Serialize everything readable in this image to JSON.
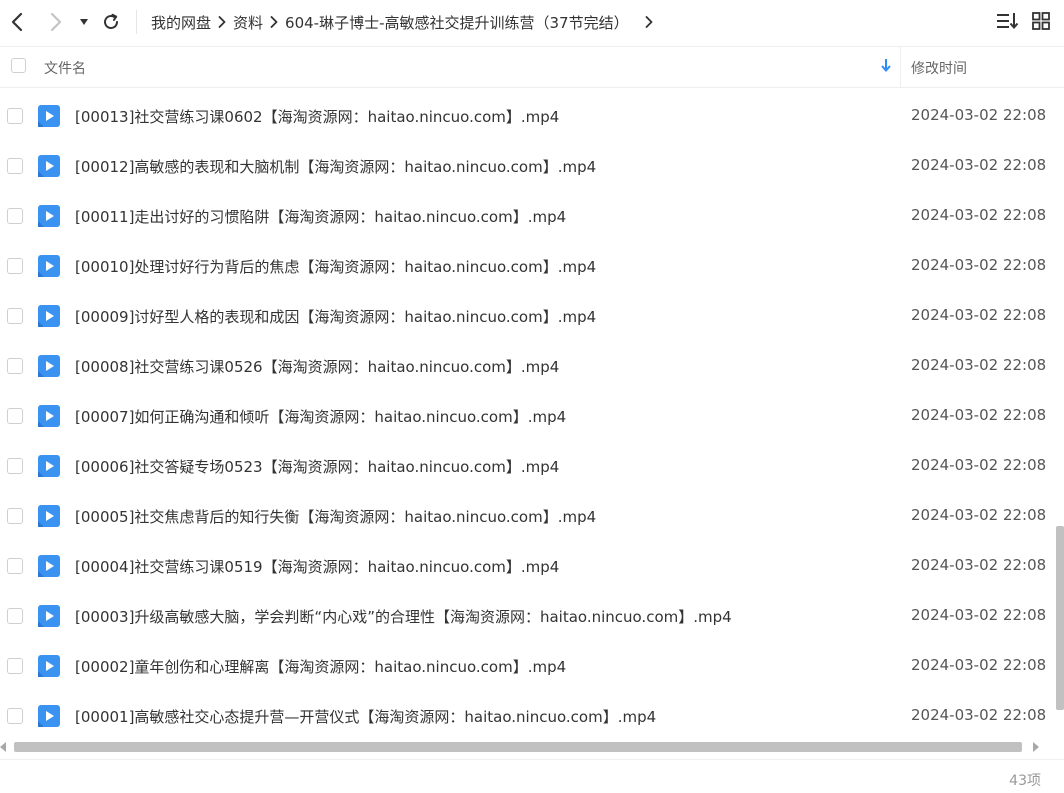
{
  "nav": {
    "back_icon": "chevron-left-icon",
    "forward_icon": "chevron-right-icon",
    "history_icon": "caret-down-icon",
    "refresh_icon": "refresh-icon"
  },
  "breadcrumb": [
    "我的网盘",
    "资料",
    "604-琳子博士-高敏感社交提升训练营（37节完结）"
  ],
  "tools": {
    "sort_icon": "sort-list-icon",
    "view_icon": "grid-view-icon"
  },
  "header": {
    "name_label": "文件名",
    "time_label": "修改时间"
  },
  "files": [
    {
      "name": "[00013]社交营练习课0602【海淘资源网：haitao.nincuo.com】.mp4",
      "time": "2024-03-02 22:08"
    },
    {
      "name": "[00012]高敏感的表现和大脑机制【海淘资源网：haitao.nincuo.com】.mp4",
      "time": "2024-03-02 22:08"
    },
    {
      "name": "[00011]走出讨好的习惯陷阱【海淘资源网：haitao.nincuo.com】.mp4",
      "time": "2024-03-02 22:08"
    },
    {
      "name": "[00010]处理讨好行为背后的焦虑【海淘资源网：haitao.nincuo.com】.mp4",
      "time": "2024-03-02 22:08"
    },
    {
      "name": "[00009]讨好型人格的表现和成因【海淘资源网：haitao.nincuo.com】.mp4",
      "time": "2024-03-02 22:08"
    },
    {
      "name": "[00008]社交营练习课0526【海淘资源网：haitao.nincuo.com】.mp4",
      "time": "2024-03-02 22:08"
    },
    {
      "name": "[00007]如何正确沟通和倾听【海淘资源网：haitao.nincuo.com】.mp4",
      "time": "2024-03-02 22:08"
    },
    {
      "name": "[00006]社交答疑专场0523【海淘资源网：haitao.nincuo.com】.mp4",
      "time": "2024-03-02 22:08"
    },
    {
      "name": "[00005]社交焦虑背后的知行失衡【海淘资源网：haitao.nincuo.com】.mp4",
      "time": "2024-03-02 22:08"
    },
    {
      "name": "[00004]社交营练习课0519【海淘资源网：haitao.nincuo.com】.mp4",
      "time": "2024-03-02 22:08"
    },
    {
      "name": "[00003]升级高敏感大脑，学会判断“内心戏”的合理性【海淘资源网：haitao.nincuo.com】.mp4",
      "time": "2024-03-02 22:08"
    },
    {
      "name": "[00002]童年创伤和心理解离【海淘资源网：haitao.nincuo.com】.mp4",
      "time": "2024-03-02 22:08"
    },
    {
      "name": "[00001]高敏感社交心态提升营—开营仪式【海淘资源网：haitao.nincuo.com】.mp4",
      "time": "2024-03-02 22:08"
    }
  ],
  "footer": {
    "count": "43项"
  },
  "colors": {
    "accent": "#2f8ef4",
    "video_icon": "#3a93f0",
    "text": "#333333",
    "muted": "#999999"
  }
}
